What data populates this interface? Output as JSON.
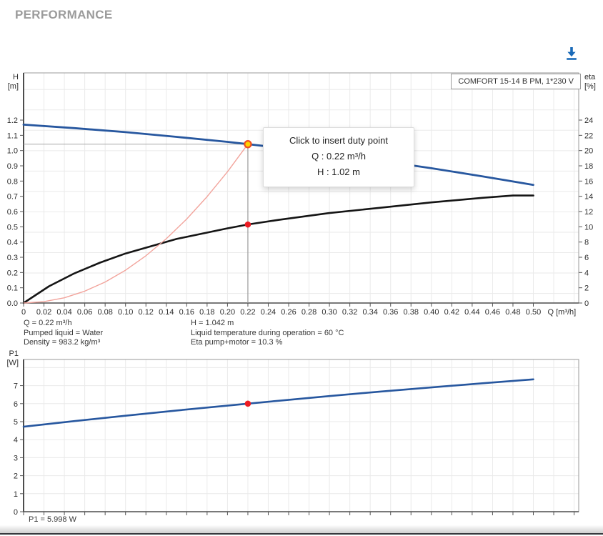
{
  "header": {
    "title": "PERFORMANCE"
  },
  "toolbar": {
    "download_icon": "download-icon",
    "accent_color": "#1a6ab8"
  },
  "chart_data": [
    {
      "id": "hq-eta",
      "type": "line",
      "legend": "COMFORT 15-14 B PM, 1*230 V",
      "x_axis": {
        "label": "Q [m³/h]",
        "min": 0,
        "max": 0.5445,
        "tick_step": 0.02,
        "tick_end": 0.5,
        "grid": true
      },
      "y_axis_left": {
        "label_lines": [
          "H",
          "[m]"
        ],
        "min": 0,
        "max": 1.5096,
        "tick_step": 0.1,
        "tick_end": 1.2
      },
      "y_axis_right": {
        "label_lines": [
          "eta",
          "[%]"
        ],
        "min": 0,
        "max": 30.19,
        "tick_step": 2,
        "tick_end": 24
      },
      "series": [
        {
          "name": "pump-curve",
          "axis": "left",
          "color": "#27579f",
          "width": 2.8,
          "points": [
            [
              0,
              1.17
            ],
            [
              0.05,
              1.147
            ],
            [
              0.1,
              1.121
            ],
            [
              0.15,
              1.09
            ],
            [
              0.2,
              1.057
            ],
            [
              0.22,
              1.042
            ],
            [
              0.25,
              1.019
            ],
            [
              0.3,
              0.978
            ],
            [
              0.35,
              0.933
            ],
            [
              0.4,
              0.884
            ],
            [
              0.45,
              0.831
            ],
            [
              0.5,
              0.775
            ]
          ]
        },
        {
          "name": "efficiency-curve",
          "axis": "right",
          "color": "#151515",
          "width": 2.6,
          "points": [
            [
              0,
              0
            ],
            [
              0.025,
              2.2
            ],
            [
              0.05,
              3.9
            ],
            [
              0.075,
              5.3
            ],
            [
              0.1,
              6.5
            ],
            [
              0.15,
              8.4
            ],
            [
              0.2,
              9.8
            ],
            [
              0.22,
              10.3
            ],
            [
              0.25,
              10.9
            ],
            [
              0.3,
              11.8
            ],
            [
              0.35,
              12.5
            ],
            [
              0.4,
              13.2
            ],
            [
              0.45,
              13.8
            ],
            [
              0.48,
              14.1
            ],
            [
              0.5,
              14.1
            ]
          ]
        },
        {
          "name": "system-curve",
          "axis": "left",
          "color": "#f2a49c",
          "width": 1.4,
          "points": [
            [
              0,
              0
            ],
            [
              0.02,
              0.009
            ],
            [
              0.04,
              0.034
            ],
            [
              0.06,
              0.078
            ],
            [
              0.08,
              0.138
            ],
            [
              0.1,
              0.215
            ],
            [
              0.12,
              0.31
            ],
            [
              0.14,
              0.422
            ],
            [
              0.16,
              0.551
            ],
            [
              0.18,
              0.698
            ],
            [
              0.2,
              0.861
            ],
            [
              0.22,
              1.042
            ]
          ]
        }
      ],
      "duty_point": {
        "q": 0.22,
        "h": 1.042,
        "eta": 10.3,
        "marker_fill": "#ffd200",
        "marker_ring": "#f04e23",
        "eta_marker_fill": "#ec1c23"
      },
      "tooltip": {
        "lines": [
          "Click to insert duty point",
          "Q : 0.22 m³/h",
          "H : 1.02 m"
        ]
      }
    },
    {
      "id": "p1",
      "type": "line",
      "x_axis": {
        "label": "",
        "min": 0,
        "max": 0.5445,
        "tick_step": 0.02,
        "tick_end": 0.54,
        "grid": true
      },
      "y_axis_left": {
        "label_lines": [
          "P1",
          "[W]"
        ],
        "min": 0,
        "max": 8.452,
        "tick_step": 1,
        "tick_end": 7
      },
      "series": [
        {
          "name": "p1-curve",
          "axis": "left",
          "color": "#27579f",
          "width": 2.6,
          "points": [
            [
              0,
              4.72
            ],
            [
              0.05,
              5.03
            ],
            [
              0.1,
              5.33
            ],
            [
              0.15,
              5.62
            ],
            [
              0.2,
              5.89
            ],
            [
              0.22,
              6.0
            ],
            [
              0.25,
              6.16
            ],
            [
              0.3,
              6.42
            ],
            [
              0.35,
              6.67
            ],
            [
              0.4,
              6.9
            ],
            [
              0.45,
              7.13
            ],
            [
              0.5,
              7.35
            ]
          ]
        }
      ],
      "marker": {
        "q": 0.22,
        "p1": 6.0,
        "fill": "#ec1c23"
      }
    }
  ],
  "info_panel": {
    "left": [
      "Q = 0.22 m³/h",
      "Pumped liquid = Water",
      "Density = 983.2 kg/m³"
    ],
    "right": [
      "H = 1.042 m",
      "Liquid temperature during operation = 60 °C",
      "Eta pump+motor = 10.3 %"
    ]
  },
  "footer": {
    "p1_readout": "P1 = 5.998 W"
  }
}
